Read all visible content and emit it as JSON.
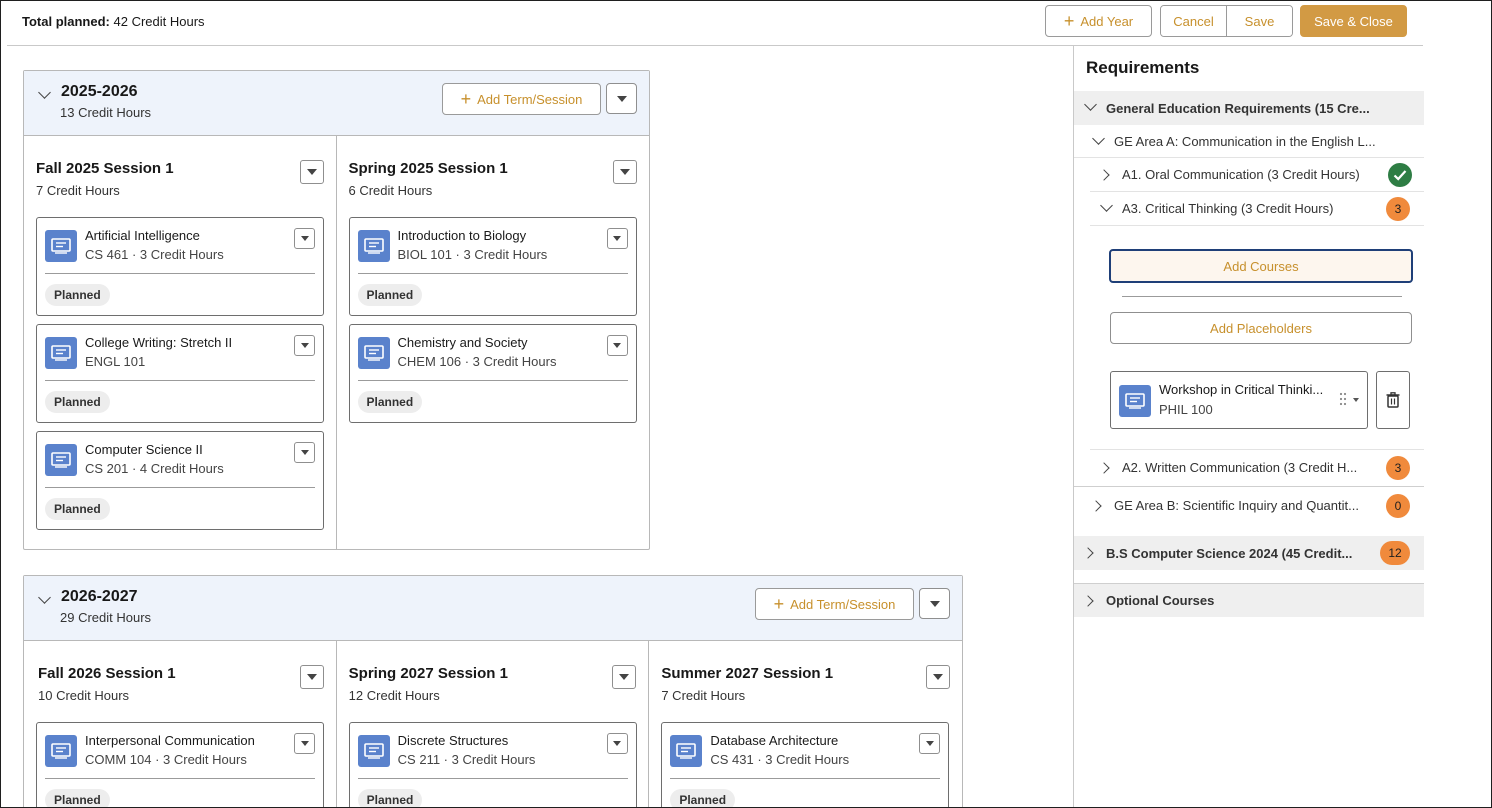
{
  "topbar": {
    "total_label": "Total planned:",
    "total_value": "42 Credit Hours",
    "add_year": "Add Year",
    "cancel": "Cancel",
    "save": "Save",
    "save_close": "Save & Close"
  },
  "years": [
    {
      "title": "2025-2026",
      "credits": "13 Credit Hours",
      "add_term": "Add Term/Session",
      "terms": [
        {
          "title": "Fall 2025 Session 1",
          "credits": "7 Credit Hours",
          "courses": [
            {
              "name": "Artificial Intelligence",
              "code": "CS 461 · 3 Credit Hours",
              "status": "Planned"
            },
            {
              "name": "College Writing: Stretch II",
              "code": "ENGL 101",
              "status": "Planned"
            },
            {
              "name": "Computer Science II",
              "code": "CS 201 · 4 Credit Hours",
              "status": "Planned"
            }
          ]
        },
        {
          "title": "Spring 2025 Session 1",
          "credits": "6 Credit Hours",
          "courses": [
            {
              "name": "Introduction to Biology",
              "code": "BIOL 101 · 3 Credit Hours",
              "status": "Planned"
            },
            {
              "name": "Chemistry and Society",
              "code": "CHEM 106 · 3 Credit Hours",
              "status": "Planned"
            }
          ]
        }
      ]
    },
    {
      "title": "2026-2027",
      "credits": "29 Credit Hours",
      "add_term": "Add Term/Session",
      "terms": [
        {
          "title": "Fall 2026 Session 1",
          "credits": "10 Credit Hours",
          "courses": [
            {
              "name": "Interpersonal Communication",
              "code": "COMM 104 · 3 Credit Hours",
              "status": "Planned"
            }
          ]
        },
        {
          "title": "Spring 2027 Session 1",
          "credits": "12 Credit Hours",
          "courses": [
            {
              "name": "Discrete Structures",
              "code": "CS 211 · 3 Credit Hours",
              "status": "Planned"
            }
          ]
        },
        {
          "title": "Summer 2027 Session 1",
          "credits": "7 Credit Hours",
          "courses": [
            {
              "name": "Database Architecture",
              "code": "CS 431 · 3 Credit Hours",
              "status": "Planned"
            }
          ]
        }
      ]
    }
  ],
  "requirements": {
    "title": "Requirements",
    "ge": "General Education Requirements (15 Cre...",
    "ge_area_a": "GE Area A: Communication in the English L...",
    "a1": "A1. Oral Communication (3 Credit Hours)",
    "a3": "A3. Critical Thinking (3 Credit Hours)",
    "a3_count": "3",
    "add_courses": "Add Courses",
    "add_placeholders": "Add Placeholders",
    "placeholder_name": "Workshop in Critical Thinki...",
    "placeholder_code": "PHIL 100",
    "a2": "A2. Written Communication (3 Credit H...",
    "a2_count": "3",
    "ge_area_b": "GE Area B: Scientific Inquiry and Quantit...",
    "ge_area_b_count": "0",
    "bs_cs": "B.S Computer Science 2024 (45 Credit...",
    "bs_cs_count": "12",
    "optional": "Optional Courses"
  },
  "colors": {
    "accent": "#c7902c",
    "primary_button": "#d29a44",
    "course_icon": "#5a82cc",
    "count_badge": "#f08a3c",
    "complete": "#2e7d44",
    "year_header": "#eef3fb"
  }
}
